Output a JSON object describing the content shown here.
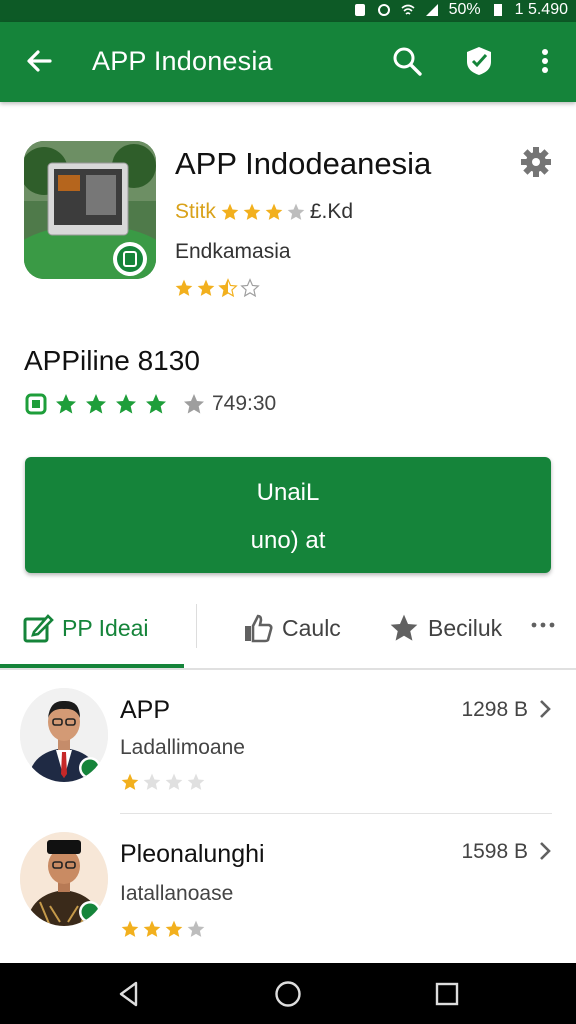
{
  "status_bar": {
    "battery": "50%",
    "time": "1 5.490"
  },
  "app_bar": {
    "title": "APP Indonesia",
    "icons": [
      "back-arrow-icon",
      "search-icon",
      "verified-icon",
      "more-vert-icon"
    ]
  },
  "app": {
    "title": "APP Indodeanesia",
    "dev_stars_label": "Stitk",
    "meta": "£.Kd",
    "category": "Endkamasia",
    "rating_stars": 2.5
  },
  "section": {
    "title": "APPiline 8130",
    "rating_stars": 5,
    "rating_count": "749:30"
  },
  "install_button": {
    "line1": "UnaiL",
    "line2": "uno) at"
  },
  "tabs": [
    {
      "label": "PP Ideai",
      "icon": "edit-icon",
      "active": true
    },
    {
      "label": "Caulc",
      "icon": "thumbs-up-icon",
      "active": false
    },
    {
      "label": "Beciluk",
      "icon": "star-icon",
      "active": false
    }
  ],
  "list": [
    {
      "name": "APP",
      "subtitle": "Ladallimoane",
      "size": "1298 B",
      "stars": 1
    },
    {
      "name": "Pleonalunghi",
      "subtitle": "Iatallanoase",
      "size": "1598 B",
      "stars": 3
    }
  ],
  "colors": {
    "primary": "#15843a",
    "status_bar": "#0d5a26",
    "star_gold": "#f2b01e",
    "star_green": "#1e9e3a"
  }
}
